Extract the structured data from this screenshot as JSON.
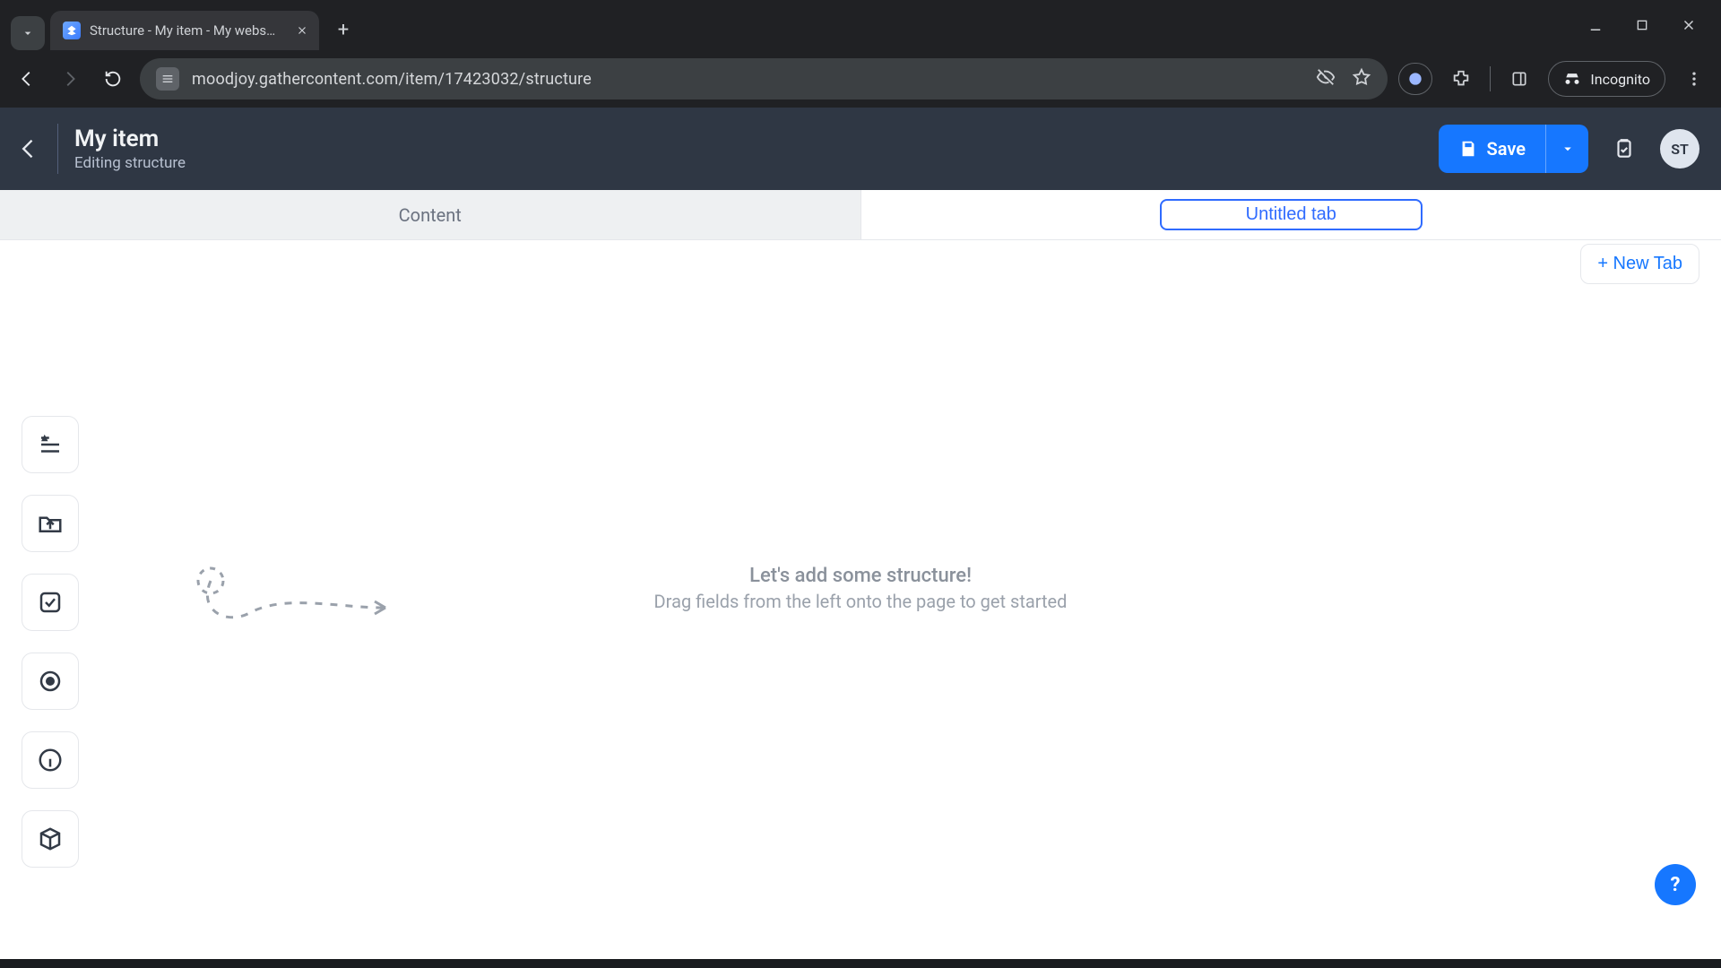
{
  "browser": {
    "tab_title": "Structure - My item - My webs…",
    "url": "moodjoy.gathercontent.com/item/17423032/structure",
    "incognito_label": "Incognito"
  },
  "header": {
    "title": "My item",
    "subtitle": "Editing structure",
    "save_label": "Save",
    "avatar_initials": "ST"
  },
  "tabs": {
    "content_label": "Content",
    "untitled_value": "Untitled tab",
    "new_tab_label": "+ New Tab"
  },
  "empty_state": {
    "title": "Let's add some structure!",
    "subtitle": "Drag fields from the left onto the page to get started"
  },
  "help_label": "?"
}
